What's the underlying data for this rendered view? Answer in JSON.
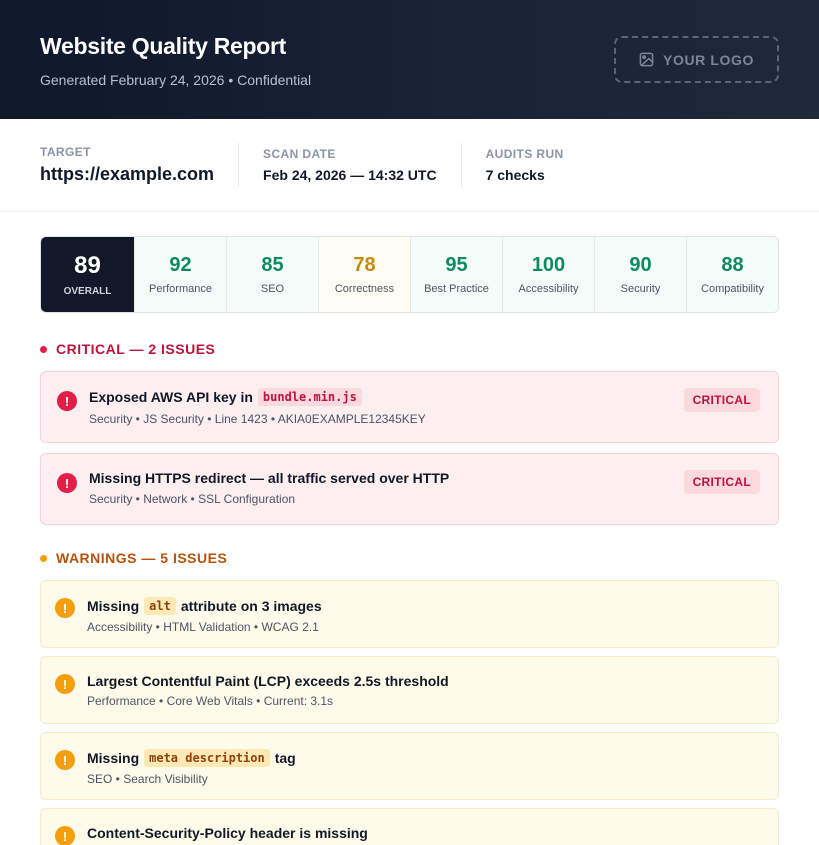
{
  "header": {
    "title": "Website Quality Report",
    "subtitle": "Generated February 24, 2026 • Confidential",
    "logo_label": "YOUR LOGO"
  },
  "meta": [
    {
      "label": "TARGET",
      "value": "https://example.com"
    },
    {
      "label": "SCAN DATE",
      "value": "Feb 24, 2026 — 14:32 UTC"
    },
    {
      "label": "AUDITS RUN",
      "value": "7 checks"
    }
  ],
  "scores": {
    "overall": {
      "value": "89",
      "label": "OVERALL"
    },
    "items": [
      {
        "value": "92",
        "label": "Performance"
      },
      {
        "value": "85",
        "label": "SEO"
      },
      {
        "value": "78",
        "label": "Correctness"
      },
      {
        "value": "95",
        "label": "Best Practice"
      },
      {
        "value": "100",
        "label": "Accessibility"
      },
      {
        "value": "90",
        "label": "Security"
      },
      {
        "value": "88",
        "label": "Compatibility"
      }
    ]
  },
  "critical": {
    "heading": "CRITICAL — 2 ISSUES",
    "issues": [
      {
        "title_before": "Exposed AWS API key in",
        "code": "bundle.min.js",
        "title_after": "",
        "meta": "Security • JS Security • Line 1423 • AKIA0EXAMPLE12345KEY",
        "badge": "CRITICAL",
        "icon": "!"
      },
      {
        "title_before": "Missing HTTPS redirect — all traffic served over HTTP",
        "code": "",
        "title_after": "",
        "meta": "Security • Network • SSL Configuration",
        "badge": "CRITICAL",
        "icon": "!"
      }
    ]
  },
  "warnings": {
    "heading": "WARNINGS — 5 ISSUES",
    "issues": [
      {
        "title_before": "Missing",
        "code": "alt",
        "title_after": "attribute on 3 images",
        "meta": "Accessibility • HTML Validation • WCAG 2.1",
        "icon": "!"
      },
      {
        "title_before": "Largest Contentful Paint (LCP) exceeds 2.5s threshold",
        "code": "",
        "title_after": "",
        "meta": "Performance • Core Web Vitals • Current: 3.1s",
        "icon": "!"
      },
      {
        "title_before": "Missing",
        "code": "meta description",
        "title_after": "tag",
        "meta": "SEO • Search Visibility",
        "icon": "!"
      },
      {
        "title_before": "Content-Security-Policy header is missing",
        "code": "",
        "title_after": "",
        "meta": "",
        "icon": "!"
      }
    ]
  },
  "colors": {
    "header_bg": "#0f172a",
    "critical": "#e11d48",
    "warning": "#f59e0b",
    "good_score": "#0f8a5f",
    "warn_score": "#c48a09"
  }
}
